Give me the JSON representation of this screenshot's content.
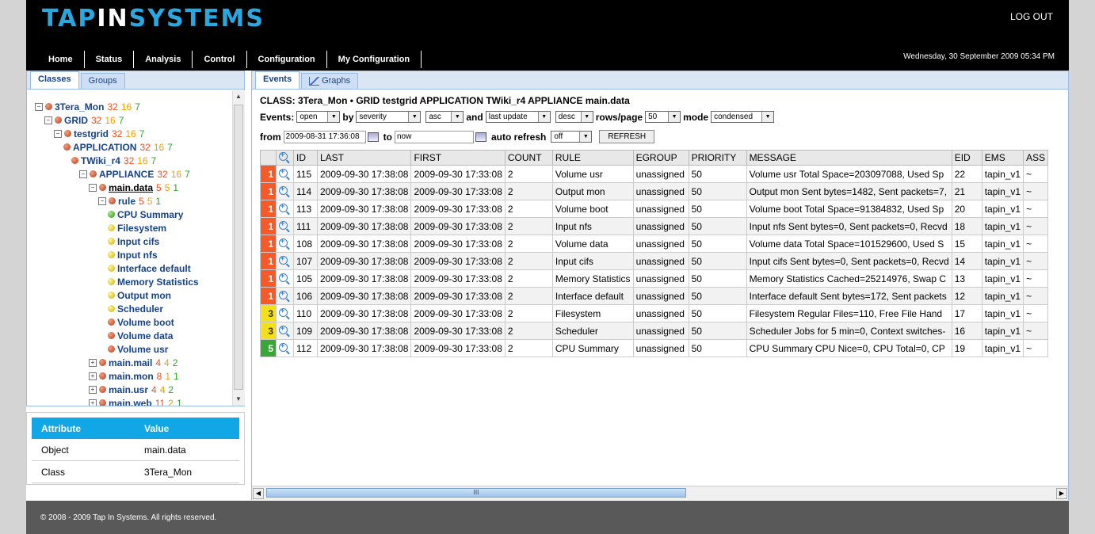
{
  "header": {
    "logo_part1": "TAP",
    "logo_part2": "IN",
    "logo_part3": "SYSTEMS",
    "logout": "LOG OUT",
    "datetime": "Wednesday, 30 September 2009 05:34 PM"
  },
  "nav": {
    "items": [
      "Home",
      "Status",
      "Analysis",
      "Control",
      "Configuration",
      "My Configuration"
    ]
  },
  "left_tabs": [
    "Classes",
    "Groups"
  ],
  "tree": [
    {
      "label": "3Tera_Mon",
      "counts": [
        "32",
        "16",
        "7"
      ]
    },
    {
      "label": "GRID",
      "counts": [
        "32",
        "16",
        "7"
      ]
    },
    {
      "label": "testgrid",
      "counts": [
        "32",
        "16",
        "7"
      ]
    },
    {
      "label": "APPLICATION",
      "counts": [
        "32",
        "16",
        "7"
      ]
    },
    {
      "label": "TWiki_r4",
      "counts": [
        "32",
        "16",
        "7"
      ]
    },
    {
      "label": "APPLIANCE",
      "counts": [
        "32",
        "16",
        "7"
      ]
    },
    {
      "label": "main.data",
      "counts": [
        "5",
        "5",
        "1"
      ]
    },
    {
      "label": "rule",
      "counts": [
        "5",
        "5",
        "1"
      ]
    },
    {
      "label": "CPU Summary"
    },
    {
      "label": "Filesystem"
    },
    {
      "label": "Input cifs"
    },
    {
      "label": "Input nfs"
    },
    {
      "label": "Interface default"
    },
    {
      "label": "Memory Statistics"
    },
    {
      "label": "Output mon"
    },
    {
      "label": "Scheduler"
    },
    {
      "label": "Volume boot"
    },
    {
      "label": "Volume data"
    },
    {
      "label": "Volume usr"
    },
    {
      "label": "main.mail",
      "counts": [
        "4",
        "4",
        "2"
      ]
    },
    {
      "label": "main.mon",
      "counts": [
        "8",
        "1",
        "1"
      ]
    },
    {
      "label": "main.usr",
      "counts": [
        "4",
        "4",
        "2"
      ]
    },
    {
      "label": "main.web",
      "counts": [
        "11",
        "2",
        "1"
      ]
    }
  ],
  "attributes": {
    "headers": [
      "Attribute",
      "Value"
    ],
    "rows": [
      [
        "Object",
        "main.data"
      ],
      [
        "Class",
        "3Tera_Mon"
      ]
    ]
  },
  "right_tabs": [
    "Events",
    "Graphs"
  ],
  "class_line": "CLASS: 3Tera_Mon • GRID testgrid APPLICATION TWiki_r4 APPLIANCE main.data",
  "filters": {
    "events_label": "Events:",
    "status": "open",
    "by_label": "by",
    "sort_field": "severity",
    "sort_dir": "asc",
    "and_label": "and",
    "sort2_field": "last update",
    "sort2_dir": "desc",
    "rows_label": "rows/page",
    "rows": "50",
    "mode_label": "mode",
    "mode": "condensed",
    "from_label": "from",
    "from_value": "2009-08-31 17:36:08",
    "to_label": "to",
    "to_value": "now",
    "auto_label": "auto refresh",
    "auto_value": "off",
    "refresh": "REFRESH"
  },
  "grid": {
    "headers": [
      "",
      "",
      "ID",
      "LAST",
      "FIRST",
      "COUNT",
      "RULE",
      "EGROUP",
      "PRIORITY",
      "MESSAGE",
      "EID",
      "EMS",
      "ASS"
    ],
    "rows": [
      [
        "1",
        "115",
        "2009-09-30 17:38:08",
        "2009-09-30 17:33:08",
        "2",
        "Volume usr",
        "unassigned",
        "50",
        "Volume usr Total Space=203097088, Used Sp",
        "22",
        "tapin_v1",
        "~"
      ],
      [
        "1",
        "114",
        "2009-09-30 17:38:08",
        "2009-09-30 17:33:08",
        "2",
        "Output mon",
        "unassigned",
        "50",
        "Output mon Sent bytes=1482, Sent packets=7,",
        "21",
        "tapin_v1",
        "~"
      ],
      [
        "1",
        "113",
        "2009-09-30 17:38:08",
        "2009-09-30 17:33:08",
        "2",
        "Volume boot",
        "unassigned",
        "50",
        "Volume boot Total Space=91384832, Used Sp",
        "20",
        "tapin_v1",
        "~"
      ],
      [
        "1",
        "111",
        "2009-09-30 17:38:08",
        "2009-09-30 17:33:08",
        "2",
        "Input nfs",
        "unassigned",
        "50",
        "Input nfs Sent bytes=0, Sent packets=0, Recvd",
        "18",
        "tapin_v1",
        "~"
      ],
      [
        "1",
        "108",
        "2009-09-30 17:38:08",
        "2009-09-30 17:33:08",
        "2",
        "Volume data",
        "unassigned",
        "50",
        "Volume data Total Space=101529600, Used S",
        "15",
        "tapin_v1",
        "~"
      ],
      [
        "1",
        "107",
        "2009-09-30 17:38:08",
        "2009-09-30 17:33:08",
        "2",
        "Input cifs",
        "unassigned",
        "50",
        "Input cifs Sent bytes=0, Sent packets=0, Recvd",
        "14",
        "tapin_v1",
        "~"
      ],
      [
        "1",
        "105",
        "2009-09-30 17:38:08",
        "2009-09-30 17:33:08",
        "2",
        "Memory Statistics",
        "unassigned",
        "50",
        "Memory Statistics Cached=25214976, Swap C",
        "13",
        "tapin_v1",
        "~"
      ],
      [
        "1",
        "106",
        "2009-09-30 17:38:08",
        "2009-09-30 17:33:08",
        "2",
        "Interface default",
        "unassigned",
        "50",
        "Interface default Sent bytes=172, Sent packets",
        "12",
        "tapin_v1",
        "~"
      ],
      [
        "3",
        "110",
        "2009-09-30 17:38:08",
        "2009-09-30 17:33:08",
        "2",
        "Filesystem",
        "unassigned",
        "50",
        "Filesystem Regular Files=110, Free File Hand",
        "17",
        "tapin_v1",
        "~"
      ],
      [
        "3",
        "109",
        "2009-09-30 17:38:08",
        "2009-09-30 17:33:08",
        "2",
        "Scheduler",
        "unassigned",
        "50",
        "Scheduler Jobs for 5 min=0, Context switches-",
        "16",
        "tapin_v1",
        "~"
      ],
      [
        "5",
        "112",
        "2009-09-30 17:38:08",
        "2009-09-30 17:33:08",
        "2",
        "CPU Summary",
        "unassigned",
        "50",
        "CPU Summary CPU Nice=0, CPU Total=0, CP",
        "19",
        "tapin_v1",
        "~"
      ]
    ]
  },
  "scrollbar_grip": "III",
  "footer": "© 2008 - 2009 Tap In Systems. All rights reserved.",
  "colors": {
    "accent": "#29a8e0",
    "sev1": "#f55a2a",
    "sev3": "#f3e01c",
    "sev5": "#3aa63a",
    "table_header": "#11a7e6"
  }
}
